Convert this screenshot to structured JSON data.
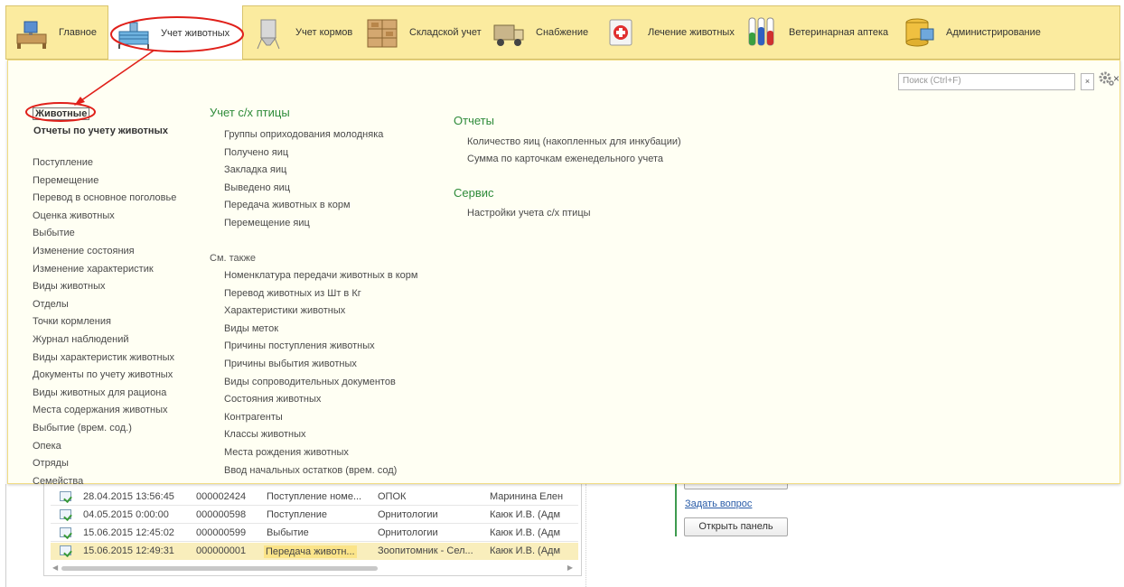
{
  "sections": [
    {
      "label": "Главное",
      "icon": "desk-icon"
    },
    {
      "label": "Учет животных",
      "icon": "farm-icon",
      "active": true
    },
    {
      "label": "Учет кормов",
      "icon": "silo-icon"
    },
    {
      "label": "Складской учет",
      "icon": "warehouse-icon"
    },
    {
      "label": "Снабжение",
      "icon": "truck-icon"
    },
    {
      "label": "Лечение животных",
      "icon": "first-aid-icon"
    },
    {
      "label": "Ветеринарная аптека",
      "icon": "test-tubes-icon"
    },
    {
      "label": "Администрирование",
      "icon": "database-icon"
    }
  ],
  "search": {
    "placeholder": "Поиск (Ctrl+F)",
    "clear": "×"
  },
  "close": "×",
  "col1": {
    "bold_items": [
      "Животные",
      "Отчеты по учету животных"
    ],
    "items": [
      "Поступление",
      "Перемещение",
      "Перевод в основное поголовье",
      "Оценка животных",
      "Выбытие",
      "Изменение состояния",
      "Изменение характеристик",
      "Виды животных",
      "Отделы",
      "Точки кормления",
      "Журнал наблюдений",
      "Виды характеристик животных",
      "Документы по учету животных",
      "Виды животных для рациона",
      "Места содержания животных",
      "Выбытие (врем. сод.)",
      "Опека",
      "Отряды",
      "Семейства"
    ]
  },
  "col2": {
    "head": "Учет с/х птицы",
    "items": [
      "Группы оприходования молодняка",
      "Получено яиц",
      "Закладка яиц",
      "Выведено яиц",
      "Передача животных в корм",
      "Перемещение яиц"
    ],
    "see_also": "См. также",
    "see_items": [
      "Номенклатура передачи животных в корм",
      "Перевод животных из Шт в Кг",
      "Характеристики животных",
      "Виды меток",
      "Причины поступления животных",
      "Причины выбытия животных",
      "Виды сопроводительных документов",
      "Состояния животных",
      "Контрагенты",
      "Классы животных",
      "Места рождения животных",
      "Ввод начальных остатков (врем. сод)"
    ]
  },
  "col3": {
    "reports_head": "Отчеты",
    "reports": [
      "Количество яиц (накопленных для инкубации)",
      "Сумма по карточкам еженедельного учета"
    ],
    "service_head": "Сервис",
    "service": [
      "Настройки учета с/х птицы"
    ]
  },
  "table_rows": [
    {
      "date": "28.04.2015 13:56:45",
      "num": "000002424",
      "type": "Поступление номе...",
      "org": "ОПОК",
      "user": "Маринина Елен"
    },
    {
      "date": "04.05.2015 0:00:00",
      "num": "000000598",
      "type": "Поступление",
      "org": "Орнитологии",
      "user": "Каюк И.В. (Адм"
    },
    {
      "date": "15.06.2015 12:45:02",
      "num": "000000599",
      "type": "Выбытие",
      "org": "Орнитологии",
      "user": "Каюк И.В. (Адм"
    },
    {
      "date": "15.06.2015 12:49:31",
      "num": "000000001",
      "type": "Передача животн...",
      "org": "Зоопитомник - Сел...",
      "user": "Каюк И.В. (Адм",
      "selected": true
    }
  ],
  "side": {
    "ask": "Задать вопрос",
    "open_panel": "Открыть панель"
  },
  "colors": {
    "accent_green": "#2e8b3a",
    "bar_yellow": "#fbeb9f",
    "annotation_red": "#e0201a"
  }
}
